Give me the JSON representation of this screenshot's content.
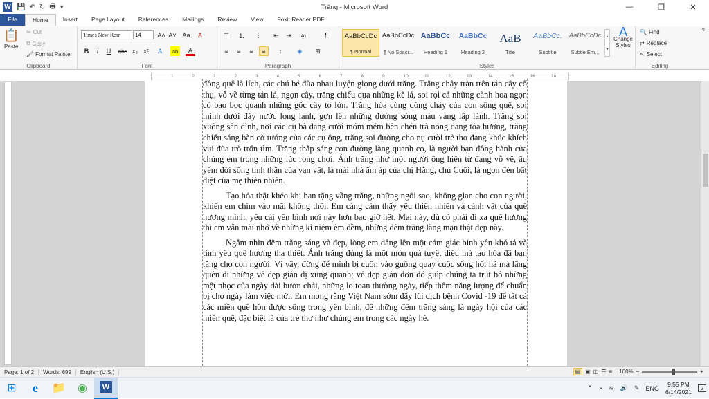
{
  "window": {
    "title": "Trăng - Microsoft Word",
    "qat": {
      "word_logo": "W",
      "save": "💾",
      "undo": "↶",
      "redo": "↻",
      "print": "🖶",
      "customize": "▾"
    },
    "controls": {
      "minimize": "—",
      "restore": "❐",
      "close": "✕"
    }
  },
  "tabs": [
    "File",
    "Home",
    "Insert",
    "Page Layout",
    "References",
    "Mailings",
    "Review",
    "View",
    "Foxit Reader PDF"
  ],
  "ribbon": {
    "clipboard": {
      "paste": "Paste",
      "cut": "Cut",
      "copy": "Copy",
      "format_painter": "Format Painter",
      "label": "Clipboard"
    },
    "font": {
      "name": "Times New Rom",
      "size": "14",
      "grow": "A˄",
      "shrink": "A˅",
      "case": "Aa",
      "clear": "A",
      "bold": "B",
      "italic": "I",
      "underline": "U",
      "strike": "abc",
      "subscript": "x₂",
      "superscript": "x²",
      "effects": "A",
      "highlight": "ab",
      "color": "A",
      "label": "Font"
    },
    "paragraph": {
      "bullets": "☰",
      "numbering": "⒈",
      "multilevel": "⋮",
      "decrease_indent": "⇤",
      "increase_indent": "⇥",
      "sort": "A↓",
      "show_marks": "¶",
      "align_left": "≡",
      "center": "≡",
      "align_right": "≡",
      "justify": "≡",
      "line_spacing": "↕",
      "shading": "◈",
      "borders": "⊞",
      "label": "Paragraph"
    },
    "styles": {
      "items": [
        {
          "sample": "AaBbCcDc",
          "name": "¶ Normal"
        },
        {
          "sample": "AaBbCcDc",
          "name": "¶ No Spaci..."
        },
        {
          "sample": "AaBbCc",
          "name": "Heading 1"
        },
        {
          "sample": "AaBbCc",
          "name": "Heading 2"
        },
        {
          "sample": "AaB",
          "name": "Title"
        },
        {
          "sample": "AaBbCc.",
          "name": "Subtitle"
        },
        {
          "sample": "AaBbCcDc",
          "name": "Subtle Em..."
        }
      ],
      "change_styles": "Change Styles",
      "label": "Styles"
    },
    "editing": {
      "find": "Find",
      "replace": "Replace",
      "select": "Select",
      "label": "Editing"
    }
  },
  "ruler": {
    "ticks": [
      "1",
      "2",
      "1",
      "2",
      "3",
      "4",
      "5",
      "6",
      "7",
      "8",
      "9",
      "10",
      "11",
      "12",
      "13",
      "14",
      "15",
      "16",
      "18"
    ]
  },
  "document": {
    "paragraphs": [
      "đồng quê là lích, các chú bé đùa nhau luyện giọng dưới trăng. Trăng chảy tràn trên tán cây cổ thụ, vỗ về từng tán lá, ngọn cây, trăng chiếu qua những kẽ lá, soi rọi cả những cành hoa ngọn cỏ bao bọc quanh những gốc cây to lớn. Trăng hòa cùng dòng chảy của con sông quê, soi mình dưới đáy nước long lanh, gợn lên những đường sóng màu vàng lấp lánh. Trăng soi xuống sân đình, nơi các cụ bà đang cười móm mém bên chén trà nóng đang tỏa hương, trăng chiếu sáng bàn cờ tướng của các cụ ông, trăng soi đường cho nụ cười trẻ thơ đang khúc khích vui đùa trò trốn tìm. Trăng thắp sáng con đường làng quanh co, là người bạn đồng hành của chúng em trong những lúc rong chơi. Ánh trăng như một người ông hiền từ đang vỗ về, âu yếm đời sống tinh thần của vạn vật, là mái nhà ấm áp của chị Hằng, chú Cuội, là ngọn đèn bất diệt của mẹ thiên nhiên.",
      "Tạo hóa thật khéo khi ban tặng vầng trăng, những ngôi sao, không gian cho con người, khiến em chìm vào mãi không thôi. Em càng cảm thấy yêu thiên nhiên và cảnh vật của quê hương mình, yêu cái yên bình nơi này hơn bao giờ hết. Mai này, dù có phải đi xa quê hương thì em vẫn mãi nhớ về những kỉ niệm êm đềm, những đêm trăng lãng mạn thật đẹp này.",
      "Ngắm nhìn đêm trăng sáng và đẹp, lòng em dâng lên một cảm giác bình yên khó tả và tình yêu quê hương tha thiết. Ánh trăng đúng là một món quà tuyệt diệu mà tạo hóa đã ban tặng cho con người. Vì vậy, đừng để mình bị cuốn vào guồng quay cuộc sống hối hả mà lãng quên đi những vẻ đẹp giản dị xung quanh; vẻ đẹp giản đơn đó giúp chúng ta trút bỏ những mệt nhọc của ngày dài bươn chải, những lo toan thường ngày, tiếp thêm năng lượng để chuẩn bị cho ngày làm việc mới. Em mong rằng Việt Nam sớm đẩy lùi dịch bệnh Covid -19 để tất cả các miền quê hồn được sống trong yên bình, để những đêm trăng sáng là ngày hội của các miền quê, đặc biệt là của trẻ thơ như chúng em trong các ngày hè."
    ]
  },
  "status": {
    "page": "Page: 1 of 2",
    "words": "Words: 699",
    "language": "English (U.S.)",
    "zoom": "100%",
    "zoom_minus": "−",
    "zoom_plus": "+"
  },
  "taskbar": {
    "apps": [
      {
        "icon": "⊞",
        "name": "start-icon"
      },
      {
        "icon": "e",
        "name": "edge-icon"
      },
      {
        "icon": "📁",
        "name": "folder-icon"
      },
      {
        "icon": "◉",
        "name": "coccoc-icon"
      },
      {
        "icon": "W",
        "name": "word-taskbar-icon"
      }
    ],
    "language": "ENG",
    "time": "9:55 PM",
    "date": "6/14/2021",
    "notifications": "2"
  }
}
